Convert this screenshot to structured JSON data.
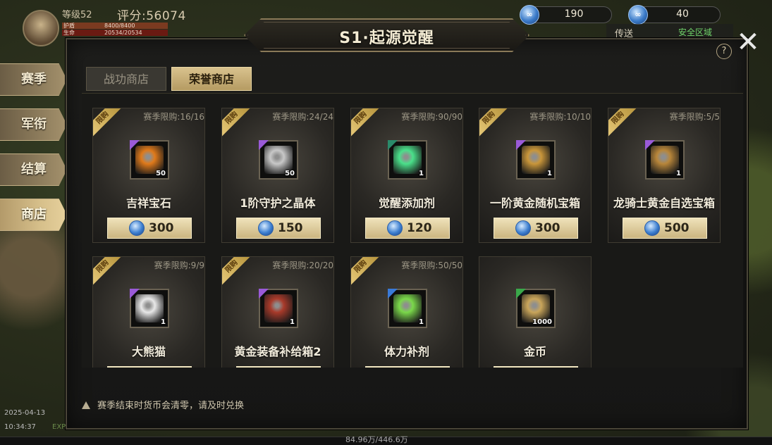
{
  "hud": {
    "level": "等级52",
    "score": "评分:56074",
    "hp_label": "护盾",
    "hp_value": "8400/8400",
    "mp_label": "生命",
    "mp_value": "20534/20534"
  },
  "currencies": [
    {
      "icon": "honor-gem-icon",
      "amount": "190"
    },
    {
      "icon": "honor-gem-icon",
      "amount": "40"
    }
  ],
  "top_right": {
    "transmit": "传送",
    "safe_zone": "安全区域"
  },
  "sidebar": {
    "items": [
      {
        "label": "赛季"
      },
      {
        "label": "军衔"
      },
      {
        "label": "结算"
      },
      {
        "label": "商店",
        "active": true
      }
    ]
  },
  "panel": {
    "title": "S1·起源觉醒",
    "help": "?",
    "close": "✕",
    "tabs": [
      {
        "label": "战功商店",
        "active": false
      },
      {
        "label": "荣誉商店",
        "active": true
      }
    ]
  },
  "items": [
    {
      "name": "吉祥宝石",
      "limit": "赛季限购:16/16",
      "qty": "50",
      "price": "300",
      "rarity": "#9a5ad8",
      "icon": "gem-icon",
      "icon_color": "#e07a1a"
    },
    {
      "name": "1阶守护之晶体",
      "limit": "赛季限购:24/24",
      "qty": "50",
      "price": "150",
      "rarity": "#9a5ad8",
      "icon": "crystal-icon",
      "icon_color": "#c8c8c8"
    },
    {
      "name": "觉醒添加剂",
      "limit": "赛季限购:90/90",
      "qty": "1",
      "price": "120",
      "rarity": "#2a8a6a",
      "icon": "spark-icon",
      "icon_color": "#4ae08a"
    },
    {
      "name": "一阶黄金随机宝箱",
      "limit": "赛季限购:10/10",
      "qty": "1",
      "price": "300",
      "rarity": "#9a5ad8",
      "icon": "mystery-chest-icon",
      "icon_color": "#c9963a"
    },
    {
      "name": "龙骑士黄金自选宝箱",
      "limit": "赛季限购:5/5",
      "qty": "1",
      "price": "500",
      "rarity": "#9a5ad8",
      "icon": "dragon-chest-icon",
      "icon_color": "#b8863a"
    },
    {
      "name": "大熊猫",
      "limit": "赛季限购:9/9",
      "qty": "1",
      "price": "",
      "rarity": "#9a5ad8",
      "icon": "panda-icon",
      "icon_color": "#e8e8e8"
    },
    {
      "name": "黄金装备补给箱2",
      "limit": "赛季限购:20/20",
      "qty": "1",
      "price": "",
      "rarity": "#9a5ad8",
      "icon": "red-chest-icon",
      "icon_color": "#a83a2a"
    },
    {
      "name": "体力补剂",
      "limit": "赛季限购:50/50",
      "qty": "1",
      "price": "",
      "rarity": "#3a7ad8",
      "icon": "potion-icon",
      "icon_color": "#7ad84a"
    },
    {
      "name": "金币",
      "limit": "",
      "qty": "1000",
      "price": "",
      "rarity": "#3aa84a",
      "icon": "coin-icon",
      "icon_color": "#c9a55a"
    }
  ],
  "limited_label": "限购",
  "notice": "赛季结束时货币会清零，请及时兑换",
  "footer": {
    "date": "2025-04-13",
    "time": "10:34:37",
    "exp_label": "EXP",
    "exp_text": "84.96万/446.6万"
  }
}
